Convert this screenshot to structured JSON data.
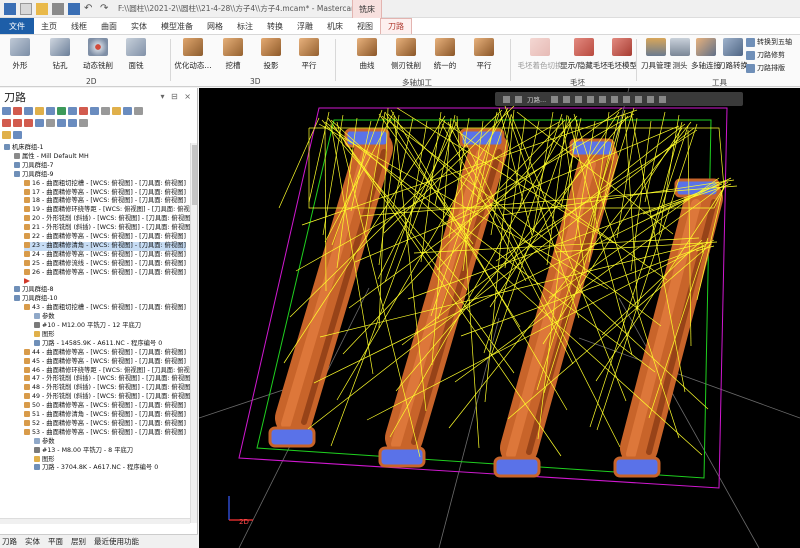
{
  "window": {
    "title": "F:\\\\圆柱\\\\2021-2\\\\圆柱\\\\21-4-28\\\\方子4\\\\方子4.mcam* - Mastercam 铣...",
    "context_tab": "铣床"
  },
  "tabs": [
    "文件",
    "主页",
    "线框",
    "曲面",
    "实体",
    "模型准备",
    "网格",
    "标注",
    "转换",
    "浮雕",
    "机床",
    "视图",
    "刀路"
  ],
  "active_tab": "刀路",
  "ribbon": {
    "buttons_2d": [
      "外形",
      "钻孔",
      "动态铣削",
      "面铣"
    ],
    "group_2d": "2D",
    "buttons_3d": [
      "优化动态...",
      "挖槽",
      "投影",
      "平行"
    ],
    "group_3d": "3D",
    "buttons_multi": [
      "曲线",
      "侧刃铣削",
      "统一的",
      "平行"
    ],
    "group_multi": "多轴加工",
    "buttons_stock": [
      "毛坯着色切换",
      "显示/隐藏毛坯",
      "毛坯模型"
    ],
    "group_stock": "毛坯",
    "buttons_tools": [
      "刀具管理",
      "测头",
      "多轴连接",
      "刀路转换"
    ],
    "group_tools": "工具",
    "small_buttons": [
      "转换到五轴",
      "刀路修剪",
      "刀路排版"
    ]
  },
  "panel": {
    "title": "刀路",
    "controls": "▾ ⊟ ×"
  },
  "tree": [
    {
      "indent": 0,
      "text": "机床群组-1",
      "icon": "folder"
    },
    {
      "indent": 1,
      "text": "属性 - Mill Default MH",
      "icon": "prop"
    },
    {
      "indent": 1,
      "text": "刀具群组-7",
      "icon": "group"
    },
    {
      "indent": 1,
      "text": "刀具群组-9",
      "icon": "group"
    },
    {
      "indent": 2,
      "text": "16 - 曲面粗切挖槽 - [WCS: 俯视图] - [刀具面: 俯视图]",
      "icon": "op"
    },
    {
      "indent": 2,
      "text": "17 - 曲面精修等高 - [WCS: 俯视图] - [刀具面: 俯视图]",
      "icon": "op"
    },
    {
      "indent": 2,
      "text": "18 - 曲面精修等高 - [WCS: 俯视图] - [刀具面: 俯视图]",
      "icon": "op"
    },
    {
      "indent": 2,
      "text": "19 - 曲面精修环绕等距 - [WCS: 俯视图] - [刀具面: 俯视",
      "icon": "op"
    },
    {
      "indent": 2,
      "text": "20 - 外形铣削 (斜插) - [WCS: 俯视图] - [刀具面: 俯视图]",
      "icon": "op"
    },
    {
      "indent": 2,
      "text": "21 - 外形铣削 (斜插) - [WCS: 俯视图] - [刀具面: 俯视图]",
      "icon": "op"
    },
    {
      "indent": 2,
      "text": "22 - 曲面精修等高 - [WCS: 俯视图] - [刀具面: 俯视图]",
      "icon": "op"
    },
    {
      "indent": 2,
      "text": "23 - 曲面精修清角 - [WCS: 俯视图] - [刀具面: 俯视图]",
      "icon": "op",
      "highlight": true
    },
    {
      "indent": 2,
      "text": "24 - 曲面精修等高 - [WCS: 俯视图] - [刀具面: 俯视图]",
      "icon": "op"
    },
    {
      "indent": 2,
      "text": "25 - 曲面精修流线 - [WCS: 俯视图] - [刀具面: 俯视图]",
      "icon": "op"
    },
    {
      "indent": 2,
      "text": "26 - 曲面精修等高 - [WCS: 俯视图] - [刀具面: 俯视图]",
      "icon": "op"
    },
    {
      "indent": 2,
      "text": "",
      "icon": "arrow"
    },
    {
      "indent": 1,
      "text": "刀具群组-8",
      "icon": "group"
    },
    {
      "indent": 1,
      "text": "刀具群组-10",
      "icon": "group"
    },
    {
      "indent": 2,
      "text": "43 - 曲面粗切挖槽 - [WCS: 俯视图] - [刀具面: 俯视图]",
      "icon": "op"
    },
    {
      "indent": 3,
      "text": "参数",
      "icon": "param"
    },
    {
      "indent": 3,
      "text": "#10 - M12.00 平铣刀 - 12 平底刀",
      "icon": "tool"
    },
    {
      "indent": 3,
      "text": "图形",
      "icon": "geom"
    },
    {
      "indent": 3,
      "text": "刀路 - 14585.9K - A611.NC - 程序编号 0",
      "icon": "path"
    },
    {
      "indent": 2,
      "text": "44 - 曲面精修等高 - [WCS: 俯视图] - [刀具面: 俯视图]",
      "icon": "op"
    },
    {
      "indent": 2,
      "text": "45 - 曲面精修等高 - [WCS: 俯视图] - [刀具面: 俯视图]",
      "icon": "op"
    },
    {
      "indent": 2,
      "text": "46 - 曲面精修环绕等距 - [WCS: 俯视图] - [刀具面: 俯视",
      "icon": "op"
    },
    {
      "indent": 2,
      "text": "47 - 外形铣削 (斜插) - [WCS: 俯视图] - [刀具面: 俯视图]",
      "icon": "op"
    },
    {
      "indent": 2,
      "text": "48 - 外形铣削 (斜插) - [WCS: 俯视图] - [刀具面: 俯视图]",
      "icon": "op"
    },
    {
      "indent": 2,
      "text": "49 - 外形铣削 (斜插) - [WCS: 俯视图] - [刀具面: 俯视图]",
      "icon": "op"
    },
    {
      "indent": 2,
      "text": "50 - 曲面精修等高 - [WCS: 俯视图] - [刀具面: 俯视图]",
      "icon": "op"
    },
    {
      "indent": 2,
      "text": "51 - 曲面精修清角 - [WCS: 俯视图] - [刀具面: 俯视图]",
      "icon": "op"
    },
    {
      "indent": 2,
      "text": "52 - 曲面精修等高 - [WCS: 俯视图] - [刀具面: 俯视图]",
      "icon": "op"
    },
    {
      "indent": 2,
      "text": "53 - 曲面精修等高 - [WCS: 俯视图] - [刀具面: 俯视图]",
      "icon": "op"
    },
    {
      "indent": 3,
      "text": "参数",
      "icon": "param"
    },
    {
      "indent": 3,
      "text": "#13 - M8.00 平铣刀 - 8 平底刀",
      "icon": "tool"
    },
    {
      "indent": 3,
      "text": "图形",
      "icon": "geom"
    },
    {
      "indent": 3,
      "text": "刀路 - 3704.8K - A617.NC - 程序编号 0",
      "icon": "path"
    }
  ],
  "bottom_tabs": [
    "刀路",
    "实体",
    "平面",
    "层别",
    "最近使用功能"
  ],
  "viewport": {
    "toolbar_label": "刀路...",
    "axis_label": "2D",
    "axis_x": "X",
    "axis_y": "Y"
  },
  "colors": {
    "file_tab": "#1d5ea8",
    "toolpath": "#ffff2a",
    "part": "#c8642a",
    "stock_green": "#1fd01f",
    "stock_magenta": "#d018d0",
    "blue": "#5a72e8"
  }
}
